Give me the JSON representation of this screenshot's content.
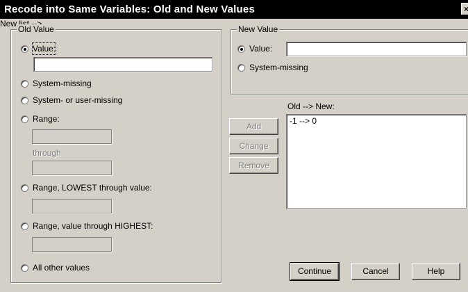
{
  "window": {
    "title": "Recode into Same Variables: Old and New Values",
    "close_glyph": "×"
  },
  "old_value": {
    "legend": "Old Value",
    "value_label": "Value:",
    "value_input": "",
    "system_missing": "System-missing",
    "system_or_user_missing": "System- or user-missing",
    "range_label": "Range:",
    "range_from": "",
    "through_label": "through",
    "range_to": "",
    "range_lowest_label": "Range, LOWEST through value:",
    "range_lowest_input": "",
    "range_highest_label": "Range, value through HIGHEST:",
    "range_highest_input": "",
    "all_other_label": "All other values",
    "selected": "value"
  },
  "new_value": {
    "legend": "New Value",
    "value_label": "Value:",
    "value_input": "",
    "system_missing": "System-missing",
    "selected": "value"
  },
  "mapping": {
    "list_label": "Old --> New:",
    "items": [
      "-1 --> 0"
    ],
    "add_label": "Add",
    "change_label": "Change",
    "remove_label": "Remove"
  },
  "footer": {
    "continue_label": "Continue",
    "cancel_label": "Cancel",
    "help_label": "Help"
  }
}
